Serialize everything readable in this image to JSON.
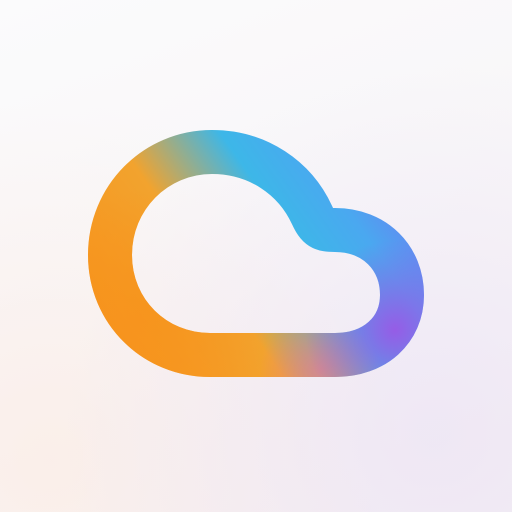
{
  "icon": {
    "name": "cloud-icon",
    "colors": {
      "gradient_start": "#F7941D",
      "gradient_mid": "#3DB7E8",
      "gradient_end": "#8B5CF6",
      "background": "#F8F6F8"
    }
  }
}
